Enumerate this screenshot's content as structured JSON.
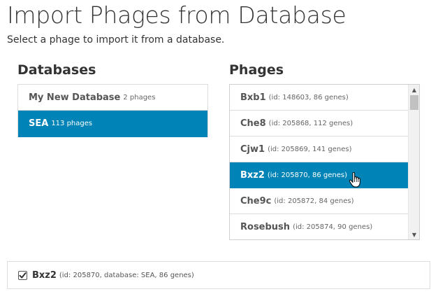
{
  "header": {
    "title": "Import Phages from Database",
    "subtitle": "Select a phage to import it from a database."
  },
  "databases": {
    "heading": "Databases",
    "items": [
      {
        "name": "My New Database",
        "meta": "2 phages",
        "active": false
      },
      {
        "name": "SEA",
        "meta": "113 phages",
        "active": true
      }
    ]
  },
  "phages": {
    "heading": "Phages",
    "items": [
      {
        "name": "Bxb1",
        "meta": "(id: 148603, 86 genes)",
        "active": false
      },
      {
        "name": "Che8",
        "meta": "(id: 205868, 112 genes)",
        "active": false
      },
      {
        "name": "Cjw1",
        "meta": "(id: 205869, 141 genes)",
        "active": false
      },
      {
        "name": "Bxz2",
        "meta": "(id: 205870, 86 genes)",
        "active": true
      },
      {
        "name": "Che9c",
        "meta": "(id: 205872, 84 genes)",
        "active": false
      },
      {
        "name": "Rosebush",
        "meta": "(id: 205874, 90 genes)",
        "active": false
      }
    ]
  },
  "selected": {
    "name": "Bxz2",
    "meta": "(id: 205870, database: SEA, 86 genes)",
    "checked": true
  },
  "colors": {
    "accent": "#0083b6"
  },
  "icons": {
    "cursor": "hand-pointer-icon",
    "scroll_up": "triangle-up-icon",
    "scroll_down": "triangle-down-icon",
    "checkbox": "checkmark-icon"
  }
}
